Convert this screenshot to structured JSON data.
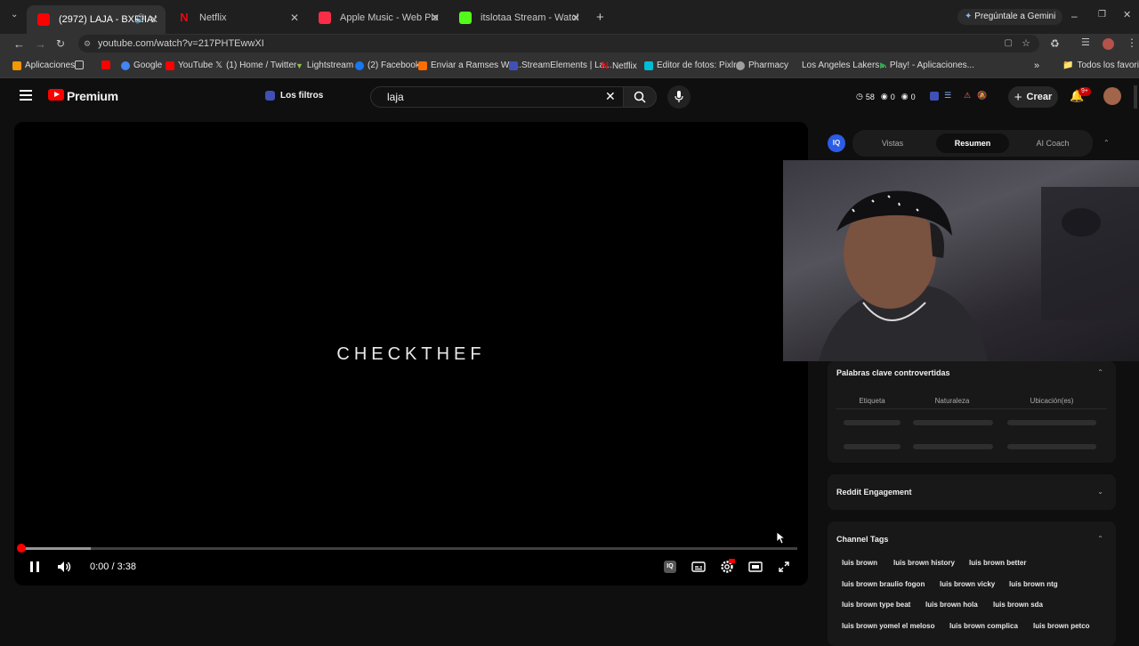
{
  "browser": {
    "tabs": [
      {
        "label": "(2972) LAJA - BXRIIA/P40 (",
        "active": true,
        "color": "#ff0000"
      },
      {
        "label": "Netflix",
        "active": false,
        "color": "#e50914"
      },
      {
        "label": "Apple Music - Web Player",
        "active": false,
        "color": "#fa2d48"
      },
      {
        "label": "itslotaa Stream - Watch Live on",
        "active": false,
        "color": "#53fc18"
      }
    ],
    "gemini_label": "Pregúntale a Gemini",
    "url": "youtube.com/watch?v=217PHTEwwXI",
    "bookmarks": [
      {
        "label": "Aplicaciones",
        "icon": "apps-grid-icon",
        "color": "#f29900"
      },
      {
        "label": "Google",
        "icon": "google-icon",
        "color": "#4285f4"
      },
      {
        "label": "YouTube",
        "icon": "youtube-icon",
        "color": "#ff0000"
      },
      {
        "label": "(1) Home / Twitter",
        "icon": "x-icon",
        "color": "#ffffff"
      },
      {
        "label": "Lightstream",
        "icon": "lightstream-icon",
        "color": "#8bc34a"
      },
      {
        "label": "(2) Facebook",
        "icon": "facebook-icon",
        "color": "#1877f2"
      },
      {
        "label": "Enviar a Ramses Wo...",
        "icon": "mail-icon",
        "color": "#ff6d00"
      },
      {
        "label": "StreamElements | La...",
        "icon": "streamelements-icon",
        "color": "#3f51b5"
      },
      {
        "label": "Netflix",
        "icon": "netflix-icon",
        "color": "#e50914"
      },
      {
        "label": "Editor de fotos: Pixlr...",
        "icon": "pixlr-icon",
        "color": "#00bcd4"
      },
      {
        "label": "Pharmacy",
        "icon": "globe-icon",
        "color": "#9e9e9e"
      },
      {
        "label": "Los Angeles Lakers...",
        "icon": "",
        "color": "#552583"
      },
      {
        "label": "Play! - Aplicaciones...",
        "icon": "play-store-icon",
        "color": "#34a853"
      }
    ],
    "all_bookmarks_label": "Todos los favoritos"
  },
  "youtube": {
    "brand": "Premium",
    "filters_label": "Los filtros",
    "search_value": "laja",
    "stats": {
      "views": "58",
      "a": "0",
      "b": "0"
    },
    "create_label": "Crear",
    "notifications": "9+"
  },
  "player": {
    "video_text": "CHECKTHEF",
    "current_time": "0:00",
    "duration": "3:38",
    "time_display": "0:00 / 3:38",
    "played_fraction": 0.0,
    "buffered_fraction": 0.09
  },
  "panel": {
    "tabs": [
      "Vistas",
      "Resumen",
      "AI Coach"
    ],
    "active_tab": "Resumen",
    "keywords_title": "Palabras clave controvertidas",
    "columns": [
      "Etiqueta",
      "Naturaleza",
      "Ubicación(es)"
    ],
    "reddit_title": "Reddit Engagement",
    "channel_tags_title": "Channel Tags",
    "tags": [
      [
        "luis brown",
        "luis brown history",
        "luis brown better"
      ],
      [
        "luis brown braulio fogon",
        "luis brown vicky",
        "luis brown ntg"
      ],
      [
        "luis brown type beat",
        "luis brown hola",
        "luis brown sda"
      ],
      [
        "luis brown yomel el meloso",
        "luis brown complica",
        "luis brown petco"
      ]
    ]
  }
}
